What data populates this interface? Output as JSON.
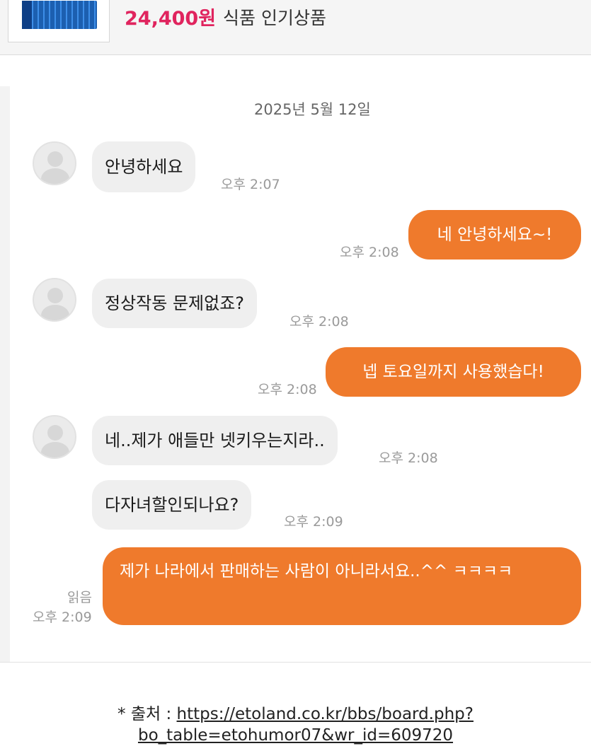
{
  "product": {
    "price": "24,400원",
    "category": "식품 인기상품"
  },
  "chat": {
    "date": "2025년 5월 12일",
    "messages": [
      {
        "from": "other",
        "text": "안녕하세요",
        "time": "오후 2:07"
      },
      {
        "from": "me",
        "text": "네 안녕하세요~!",
        "time": "오후 2:08"
      },
      {
        "from": "other",
        "text": "정상작동 문제없죠?",
        "time": "오후 2:08"
      },
      {
        "from": "me",
        "text": "넵 토요일까지 사용했습다!",
        "time": "오후 2:08"
      },
      {
        "from": "other",
        "text": "네..제가 애들만 넷키우는지라..",
        "time": "오후 2:08"
      },
      {
        "from": "other",
        "text": "다자녀할인되나요?",
        "time": "오후 2:09"
      },
      {
        "from": "me",
        "text": "제가 나라에서 판매하는 사람이 아니라서요..^^ ㅋㅋㅋㅋ",
        "time": "오후 2:09",
        "read": "읽음"
      }
    ]
  },
  "source": {
    "prefix": "* 출처 : ",
    "url": "https://etoland.co.kr/bbs/board.php?bo_table=etohumor07&wr_id=609720"
  },
  "colors": {
    "price": "#e0245e",
    "outgoing_bubble": "#ef7a2c",
    "incoming_bubble": "#efefef"
  }
}
